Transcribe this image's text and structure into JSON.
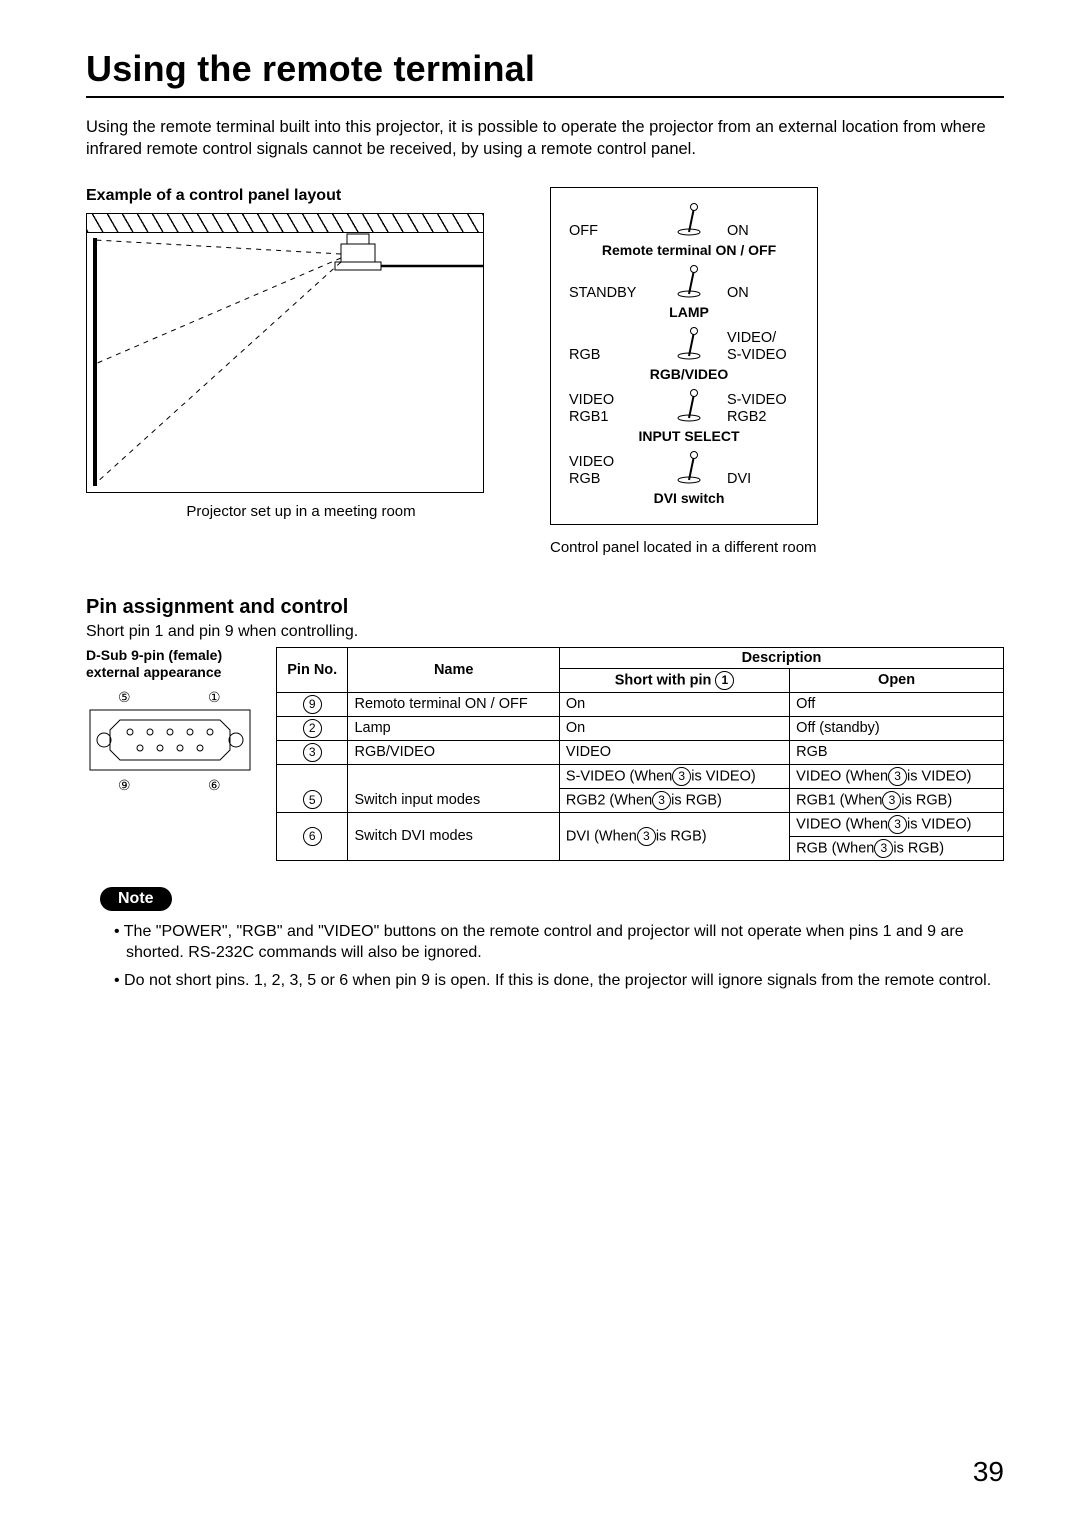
{
  "title": "Using the remote terminal",
  "intro": "Using the remote terminal built into this projector, it is possible to operate the projector from an external location from where infrared remote control signals cannot be received, by using a remote control panel.",
  "example_caption": "Example of a control panel layout",
  "room_caption": "Projector set up in a meeting room",
  "panel_caption": "Control panel located in a different room",
  "panel": {
    "rows": [
      {
        "left": "OFF",
        "right": "ON",
        "label": "Remote terminal  ON / OFF"
      },
      {
        "left": "STANDBY",
        "right": "ON",
        "label": "LAMP"
      },
      {
        "left": "RGB",
        "right": "VIDEO/\nS-VIDEO",
        "label": "RGB/VIDEO"
      },
      {
        "left": "VIDEO\nRGB1",
        "right": "S-VIDEO\nRGB2",
        "label": "INPUT SELECT"
      },
      {
        "left": "VIDEO\nRGB",
        "right": "DVI",
        "label": "DVI switch"
      }
    ]
  },
  "pin_section_title": "Pin assignment and control",
  "pin_subtext": "Short pin 1 and pin 9 when controlling.",
  "dsub_title": "D-Sub 9-pin (female) external appearance",
  "table": {
    "head": {
      "pinno": "Pin No.",
      "name": "Name",
      "desc": "Description",
      "short": "Short with pin",
      "short_num": "1",
      "open": "Open"
    },
    "rows": [
      {
        "pin": "9",
        "name": "Remoto terminal ON / OFF",
        "short": "On",
        "open": "Off"
      },
      {
        "pin": "2",
        "name": "Lamp",
        "short": "On",
        "open": "Off (standby)"
      },
      {
        "pin": "3",
        "name": "RGB/VIDEO",
        "short": "VIDEO",
        "open": "RGB"
      },
      {
        "pin": "5",
        "name": "Switch input modes",
        "short_a": "S-VIDEO (When",
        "short_a_num": "3",
        "short_a2": "is VIDEO)",
        "open_a": "VIDEO   (When",
        "open_a_num": "3",
        "open_a2": "is VIDEO)",
        "short_b": "RGB2       (When",
        "short_b_num": "3",
        "short_b2": "is RGB)",
        "open_b": "RGB1     (When",
        "open_b_num": "3",
        "open_b2": "is RGB)"
      },
      {
        "pin": "6",
        "name": "Switch DVI modes",
        "short_a": "DVI          (When",
        "short_a_num": "3",
        "short_a2": "is RGB)",
        "open_a": "VIDEO   (When",
        "open_a_num": "3",
        "open_a2": "is VIDEO)",
        "open_b": "RGB       (When",
        "open_b_num": "3",
        "open_b2": "is RGB)"
      }
    ]
  },
  "note_label": "Note",
  "notes": [
    "The \"POWER\", \"RGB\" and \"VIDEO\" buttons on the remote control and projector will not operate when pins 1 and 9 are shorted. RS-232C commands will also be ignored.",
    "Do not short pins. 1, 2, 3, 5 or 6 when pin 9 is open. If this is done, the projector will ignore signals from the remote control."
  ],
  "dsub_labels": {
    "tl": "5",
    "tr": "1",
    "bl": "9",
    "br": "6"
  },
  "page_number": "39"
}
